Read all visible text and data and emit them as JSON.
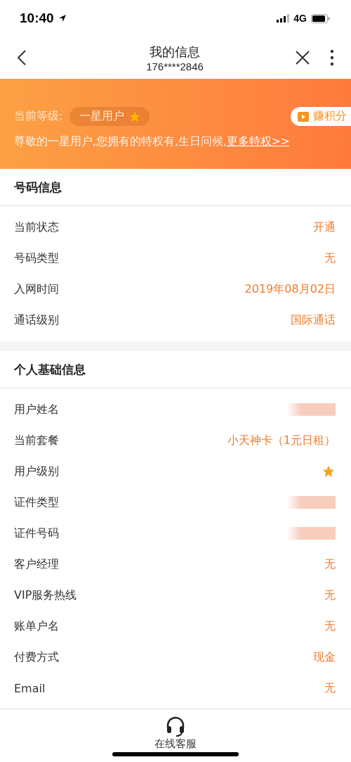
{
  "status_bar": {
    "time": "10:40",
    "network": "4G"
  },
  "nav": {
    "title": "我的信息",
    "subtitle": "176****2846"
  },
  "banner": {
    "level_label": "当前等级:",
    "level_badge": "一星用户",
    "earn_button": "赚积分",
    "message": "尊敬的一星用户,您拥有的特权有,生日问候,",
    "more_link": "更多特权>>"
  },
  "sections": [
    {
      "title": "号码信息",
      "rows": [
        {
          "label": "当前状态",
          "kind": "text",
          "value": "开通"
        },
        {
          "label": "号码类型",
          "kind": "text",
          "value": "无"
        },
        {
          "label": "入网时间",
          "kind": "text",
          "value": "2019年08月02日"
        },
        {
          "label": "通话级别",
          "kind": "text",
          "value": "国际通话"
        }
      ]
    },
    {
      "title": "个人基础信息",
      "rows": [
        {
          "label": "用户姓名",
          "kind": "redacted"
        },
        {
          "label": "当前套餐",
          "kind": "text",
          "value": "小天神卡（1元日租）"
        },
        {
          "label": "用户级别",
          "kind": "star"
        },
        {
          "label": "证件类型",
          "kind": "redacted"
        },
        {
          "label": "证件号码",
          "kind": "redacted"
        },
        {
          "label": "客户经理",
          "kind": "text",
          "value": "无"
        },
        {
          "label": "VIP服务热线",
          "kind": "text",
          "value": "无"
        },
        {
          "label": "账单户名",
          "kind": "text",
          "value": "无"
        },
        {
          "label": "付费方式",
          "kind": "text",
          "value": "现金"
        },
        {
          "label": "Email",
          "kind": "text",
          "value": "无"
        }
      ]
    }
  ],
  "bottom": {
    "service_label": "在线客服"
  }
}
